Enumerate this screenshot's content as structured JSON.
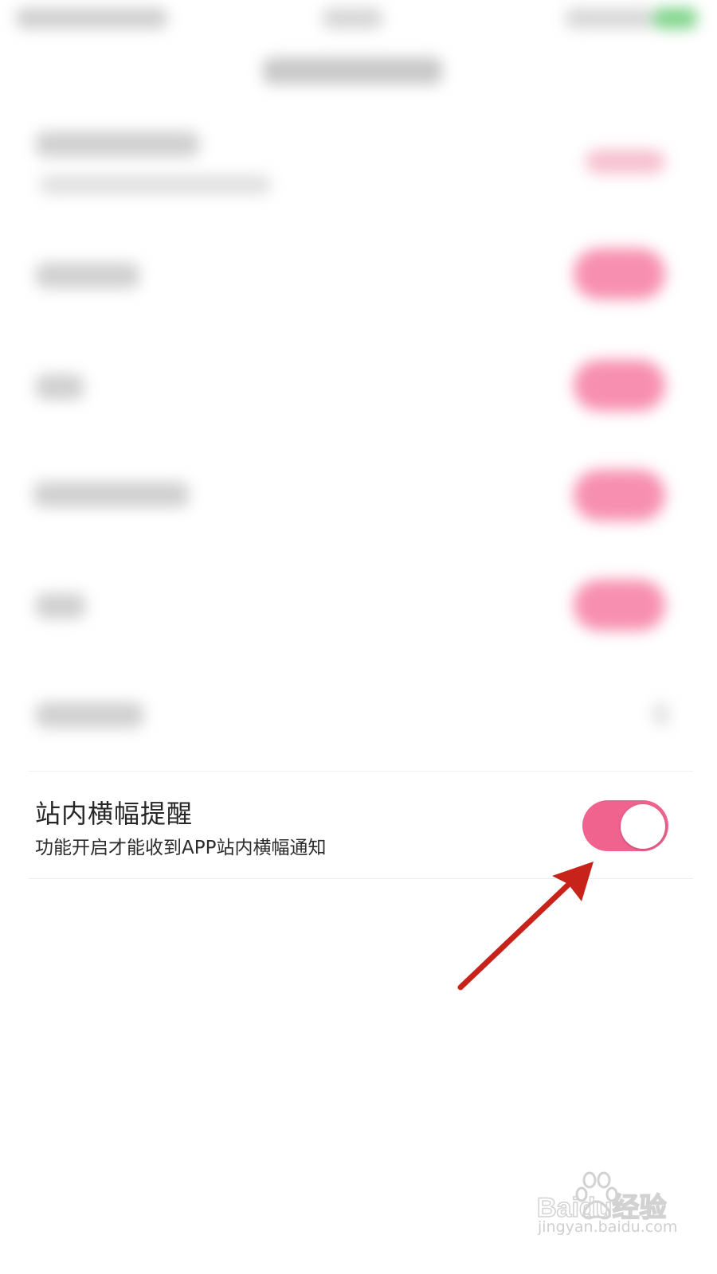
{
  "setting": {
    "title": "站内横幅提醒",
    "description": "功能开启才能收到APP站内横幅通知",
    "enabled": true
  },
  "colors": {
    "toggle_on": "#f0638f",
    "arrow": "#c7231b"
  },
  "watermark": {
    "brand": "Baidu经验",
    "url": "jingyan.baidu.com"
  }
}
